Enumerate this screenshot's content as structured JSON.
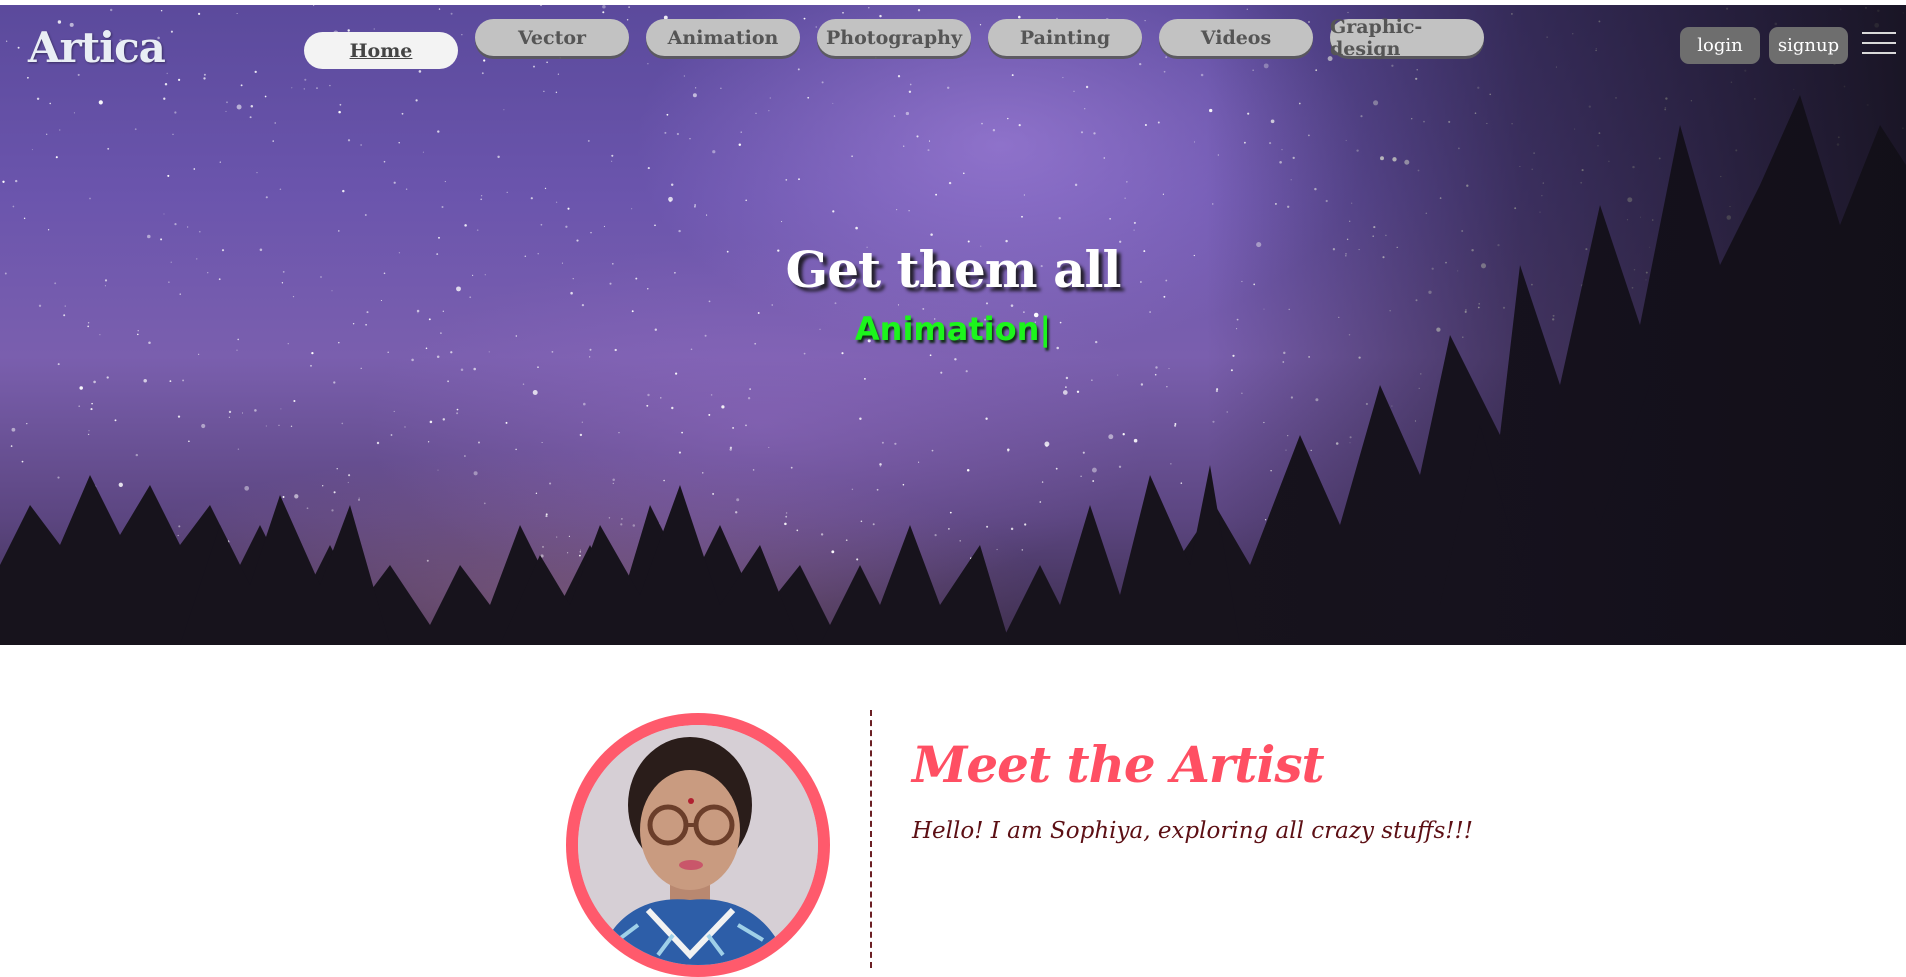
{
  "logo": {
    "text": "Artica"
  },
  "nav": {
    "items": [
      {
        "label": "Home",
        "active": true
      },
      {
        "label": "Vector"
      },
      {
        "label": "Animation"
      },
      {
        "label": "Photography"
      },
      {
        "label": "Painting"
      },
      {
        "label": "Videos"
      },
      {
        "label": "Graphic-design"
      }
    ]
  },
  "auth": {
    "login_label": "login",
    "signup_label": "signup"
  },
  "hero": {
    "title": "Get them all",
    "typed_text": "Animation",
    "caret": "|"
  },
  "artist": {
    "heading": "Meet the Artist",
    "intro": "Hello! I am Sophiya, exploring all crazy stuffs!!!"
  },
  "colors": {
    "accent_pink": "#ff4f63",
    "typed_green": "#1cf51c",
    "intro_text": "#5c0f14",
    "nav_button": "#c2c2c2",
    "auth_button": "#6e6e6e"
  },
  "icons": {
    "menu": "hamburger-menu-icon"
  }
}
